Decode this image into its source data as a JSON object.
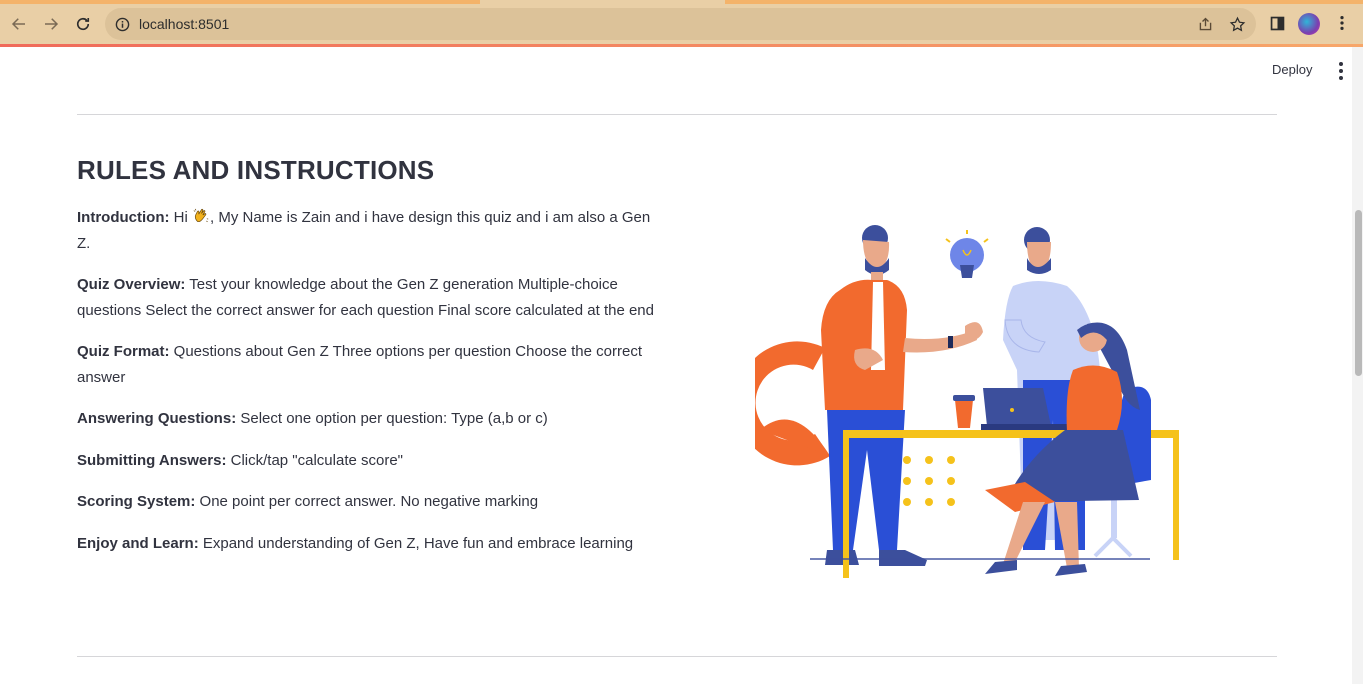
{
  "browser": {
    "url": "localhost:8501",
    "accent": "#f4b36a"
  },
  "app": {
    "deploy_label": "Deploy",
    "title": "RULES AND INSTRUCTIONS"
  },
  "rules": [
    {
      "label": "Introduction:",
      "text_before": " Hi ",
      "emoji": "waving-hand",
      "text": ", My Name is Zain and i have design this quiz and i am also a Gen Z."
    },
    {
      "label": "Quiz Overview:",
      "text": " Test your knowledge about the Gen Z generation Multiple-choice questions Select the correct answer for each question Final score calculated at the end"
    },
    {
      "label": "Quiz Format:",
      "text": " Questions about Gen Z Three options per question Choose the correct answer"
    },
    {
      "label": "Answering Questions:",
      "text": " Select one option per question: Type (a,b or c)"
    },
    {
      "label": "Submitting Answers:",
      "text": " Click/tap \"calculate score\""
    },
    {
      "label": "Scoring System:",
      "text": " One point per correct answer. No negative marking"
    },
    {
      "label": "Enjoy and Learn:",
      "text": " Expand understanding of Gen Z, Have fun and embrace learning"
    }
  ],
  "illustration": {
    "subject": "team-collaboration-illustration",
    "colors": {
      "orange": "#f26a2e",
      "blue": "#2a4fd6",
      "navy": "#3c4f9c",
      "yellow": "#f5c21b",
      "lavender": "#c8d3f7"
    }
  }
}
